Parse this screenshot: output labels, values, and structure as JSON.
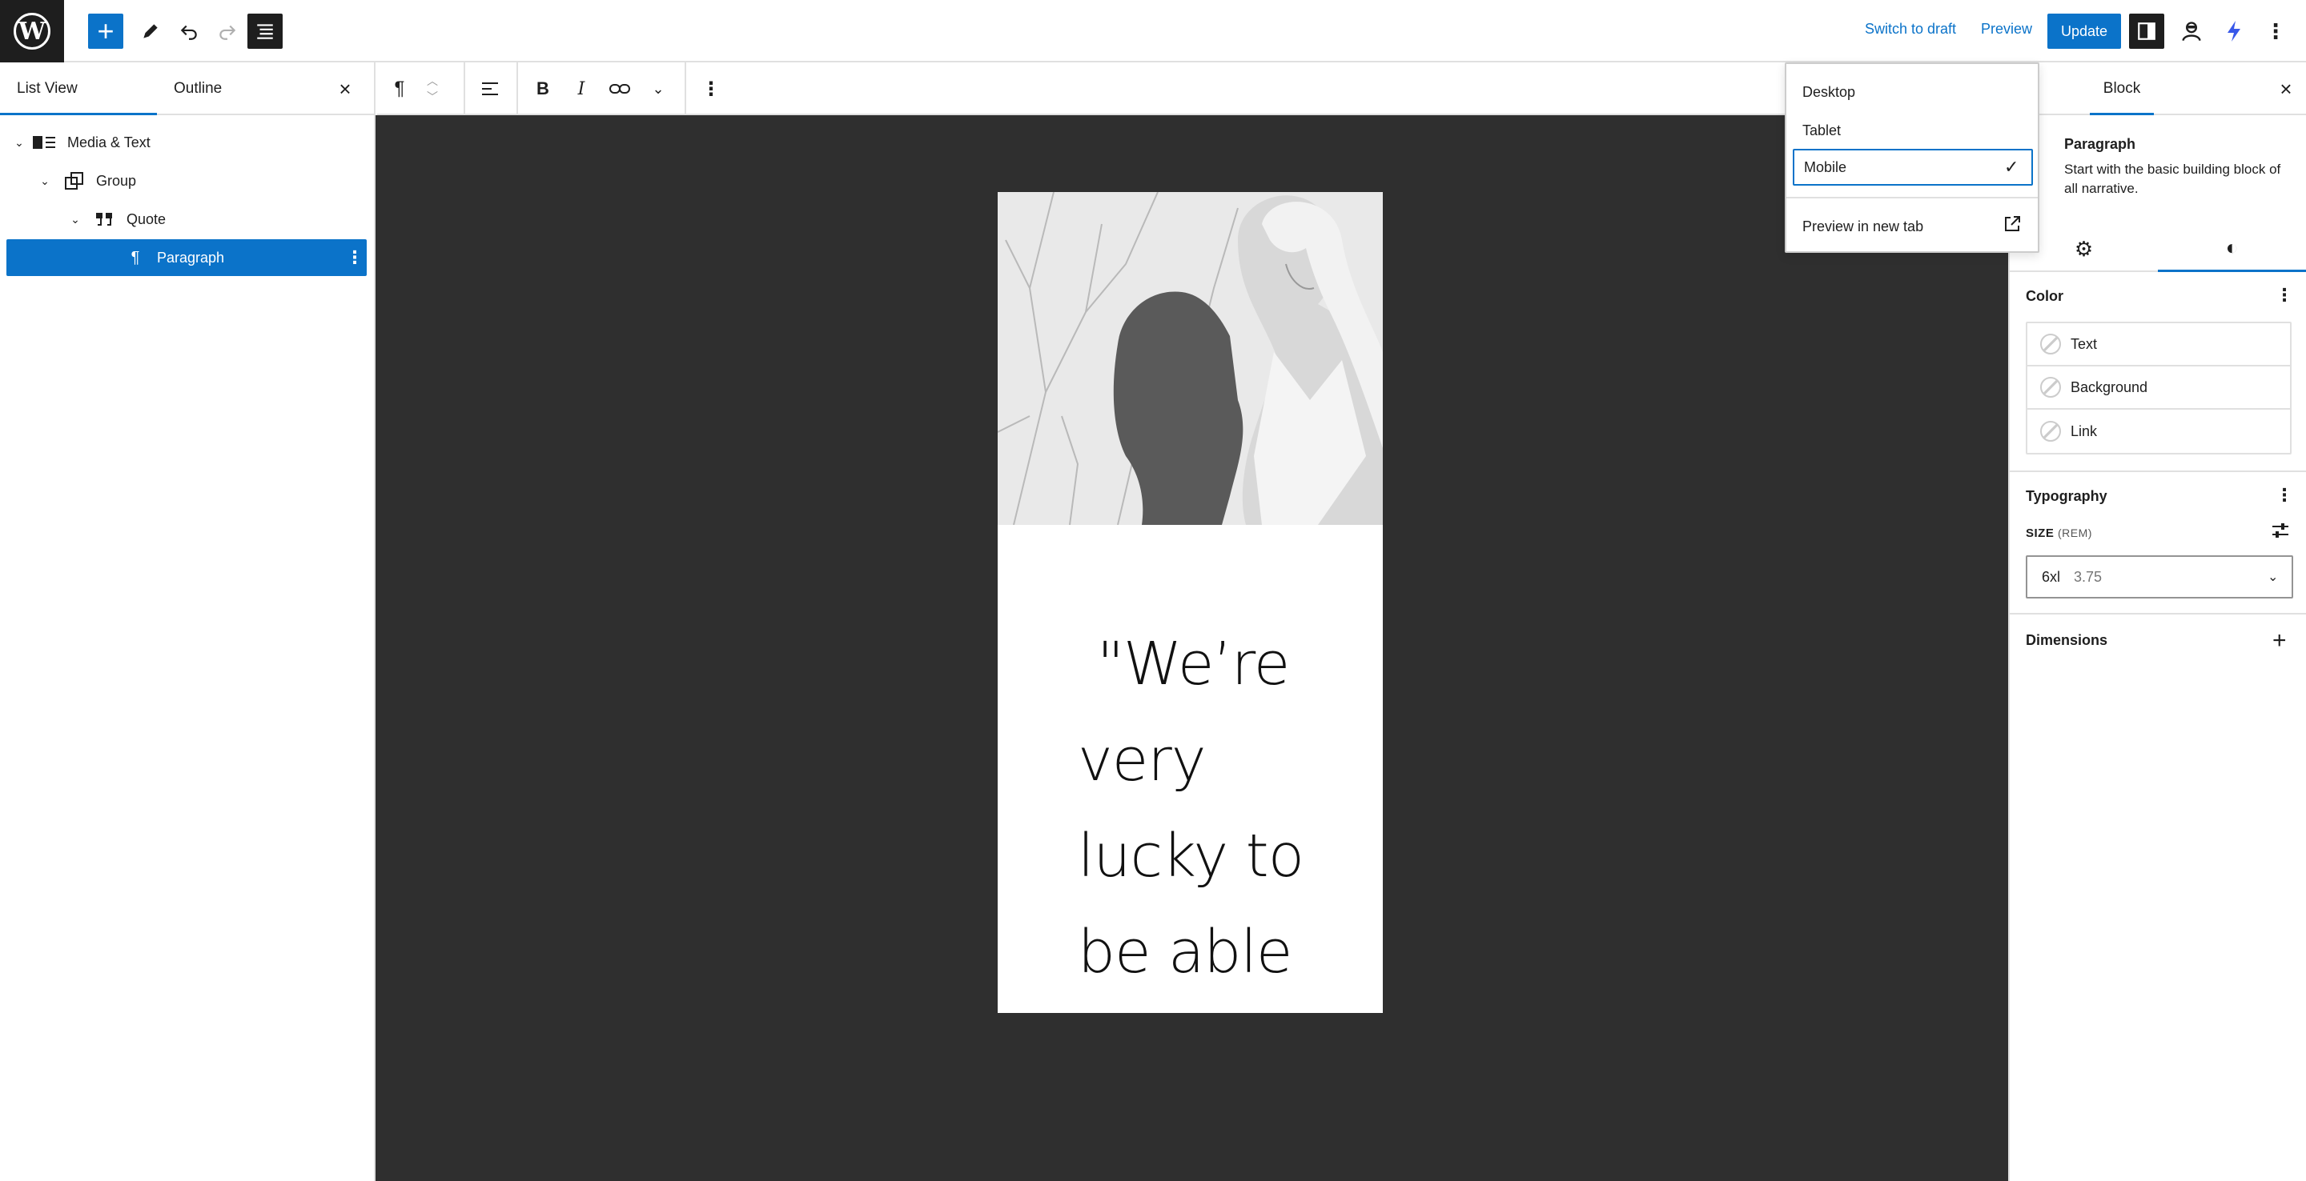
{
  "topbar": {
    "logo": "wordpress-logo",
    "inserter_icon": "plus-icon",
    "switch_to_draft": "Switch to draft",
    "preview": "Preview",
    "update": "Update"
  },
  "left_panel": {
    "tabs": [
      "List View",
      "Outline"
    ],
    "active_tab": "List View",
    "close_icon": "close-icon",
    "tree": [
      {
        "label": "Media & Text",
        "icon": "media-text-icon",
        "expanded": true
      },
      {
        "label": "Group",
        "icon": "group-icon",
        "expanded": true
      },
      {
        "label": "Quote",
        "icon": "quote-icon",
        "expanded": true
      },
      {
        "label": "Paragraph",
        "icon": "paragraph-icon",
        "selected": true
      }
    ]
  },
  "canvas": {
    "background": "#2f2f2f",
    "quote_lines": [
      "\"We’re",
      "very",
      "lucky to",
      "be able"
    ]
  },
  "preview_menu": {
    "items": [
      "Desktop",
      "Tablet",
      "Mobile"
    ],
    "selected": "Mobile",
    "preview_new_tab": "Preview in new tab"
  },
  "right_panel": {
    "tabs": [
      "Page",
      "Block"
    ],
    "visible_page_tab_fragment": "ge",
    "active_tab": "Block",
    "block": {
      "title": "Paragraph",
      "description": "Start with the basic building block of all narrative."
    },
    "color": {
      "title": "Color",
      "items": [
        "Text",
        "Background",
        "Link"
      ]
    },
    "typography": {
      "title": "Typography",
      "size_label": "SIZE",
      "size_unit": "(REM)",
      "size_name": "6xl",
      "size_value": "3.75"
    },
    "dimensions": {
      "title": "Dimensions"
    }
  },
  "colors": {
    "accent": "#0b73c9",
    "dark": "#1e1e1e"
  }
}
